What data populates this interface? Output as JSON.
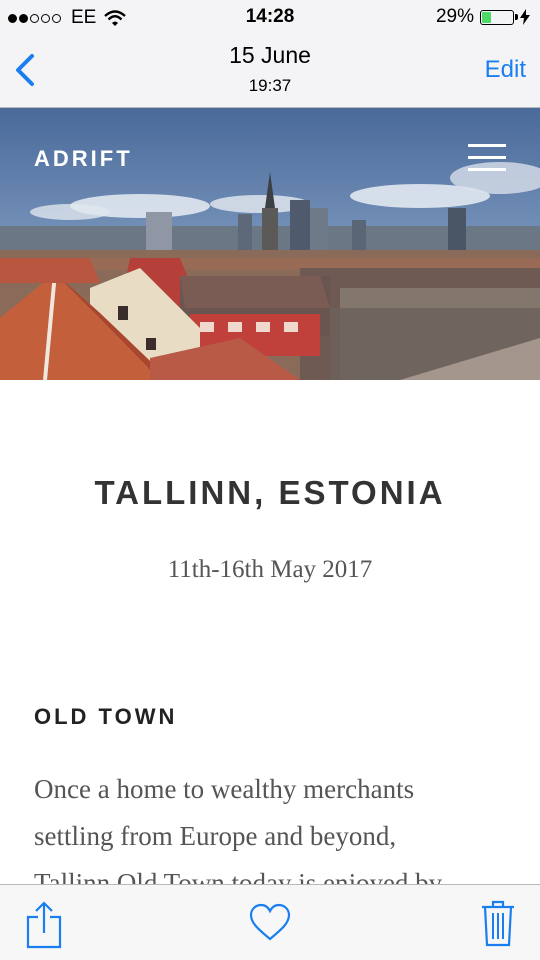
{
  "status_bar": {
    "carrier": "EE",
    "time": "14:28",
    "battery": "29%",
    "battery_level": 0.29
  },
  "nav": {
    "title": "15 June",
    "subtitle": "19:37",
    "edit_label": "Edit",
    "back_icon": "chevron-left-icon"
  },
  "article": {
    "brand": "ADRIFT",
    "menu_icon": "hamburger-menu-icon",
    "city": "TALLINN, ESTONIA",
    "dates": "11th-16th May 2017",
    "section_title": "OLD TOWN",
    "paragraph_lines": [
      "Once a home to wealthy merchants",
      "settling from Europe and beyond,",
      "Tallinn Old Town today is enjoyed by"
    ]
  },
  "toolbar": {
    "share_icon": "share-icon",
    "favorite_icon": "heart-icon",
    "delete_icon": "trash-icon"
  },
  "colors": {
    "accent": "#1a7ef0",
    "battery_fill": "#4cd964"
  }
}
